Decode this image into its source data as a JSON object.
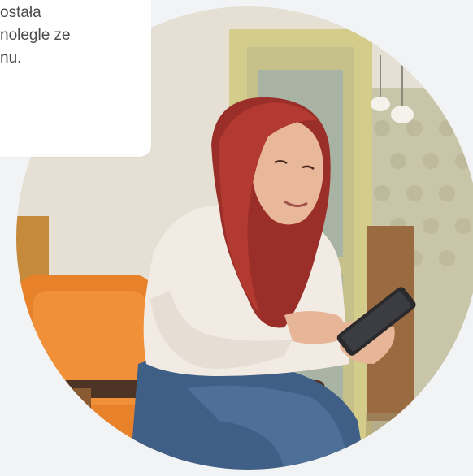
{
  "card": {
    "lines": [
      "ostała",
      "nolegle ze",
      "nu."
    ]
  },
  "photo": {
    "subject": "woman-with-tablet"
  },
  "colors": {
    "background": "#f2f3f5",
    "card": "#ffffff",
    "text": "#4a4a4a",
    "chair": "#e8822a",
    "hair": "#a2322a"
  }
}
